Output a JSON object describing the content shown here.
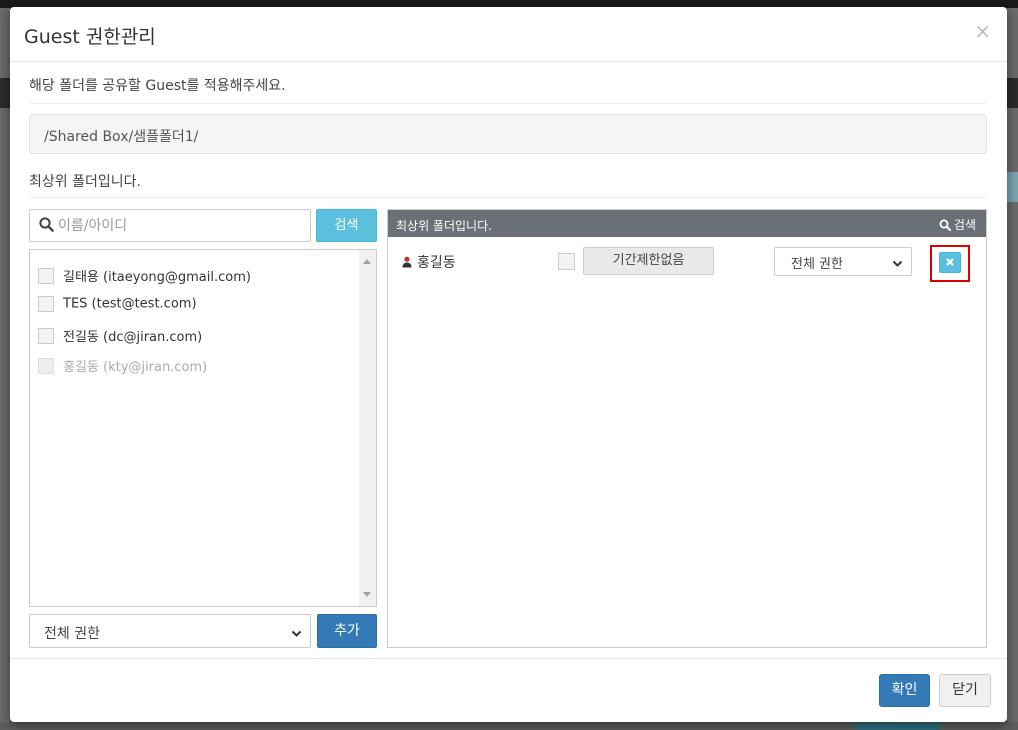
{
  "dialog": {
    "title": "Guest 권한관리",
    "close_glyph": "×",
    "description": "해당 폴더를 공유할 Guest를 적용해주세요.",
    "folder_path": "/Shared Box/샘플폴더1/",
    "top_folder_note": "최상위 폴더입니다."
  },
  "left_panel": {
    "search_placeholder": "이름/아이디",
    "search_button": "검색",
    "users": [
      {
        "label": "길태용 (itaeyong@gmail.com)",
        "disabled": false
      },
      {
        "label": "TES (test@test.com)",
        "disabled": false
      },
      {
        "label": "전길동 (dc@jiran.com)",
        "disabled": false
      },
      {
        "label": "홍길동 (kty@jiran.com)",
        "disabled": true
      }
    ],
    "permission_select": "전체 권한",
    "add_button": "추가"
  },
  "right_panel": {
    "header_title": "최상위 폴더입니다.",
    "header_search": "검색",
    "rows": [
      {
        "user_name": "홍길동",
        "period_button": "기간제한없음",
        "permission_select": "전체 권한"
      }
    ]
  },
  "footer": {
    "ok_button": "확인",
    "close_button": "닫기"
  },
  "colors": {
    "primary": "#337ab7",
    "info": "#5bc0de",
    "panel_header": "#6b7077",
    "highlight_box": "#e00000",
    "user_icon": "#c0392b"
  },
  "icons": {
    "search": "search-icon",
    "user": "user-icon",
    "delete": "close-icon",
    "dropdown": "chevron-down-icon"
  }
}
